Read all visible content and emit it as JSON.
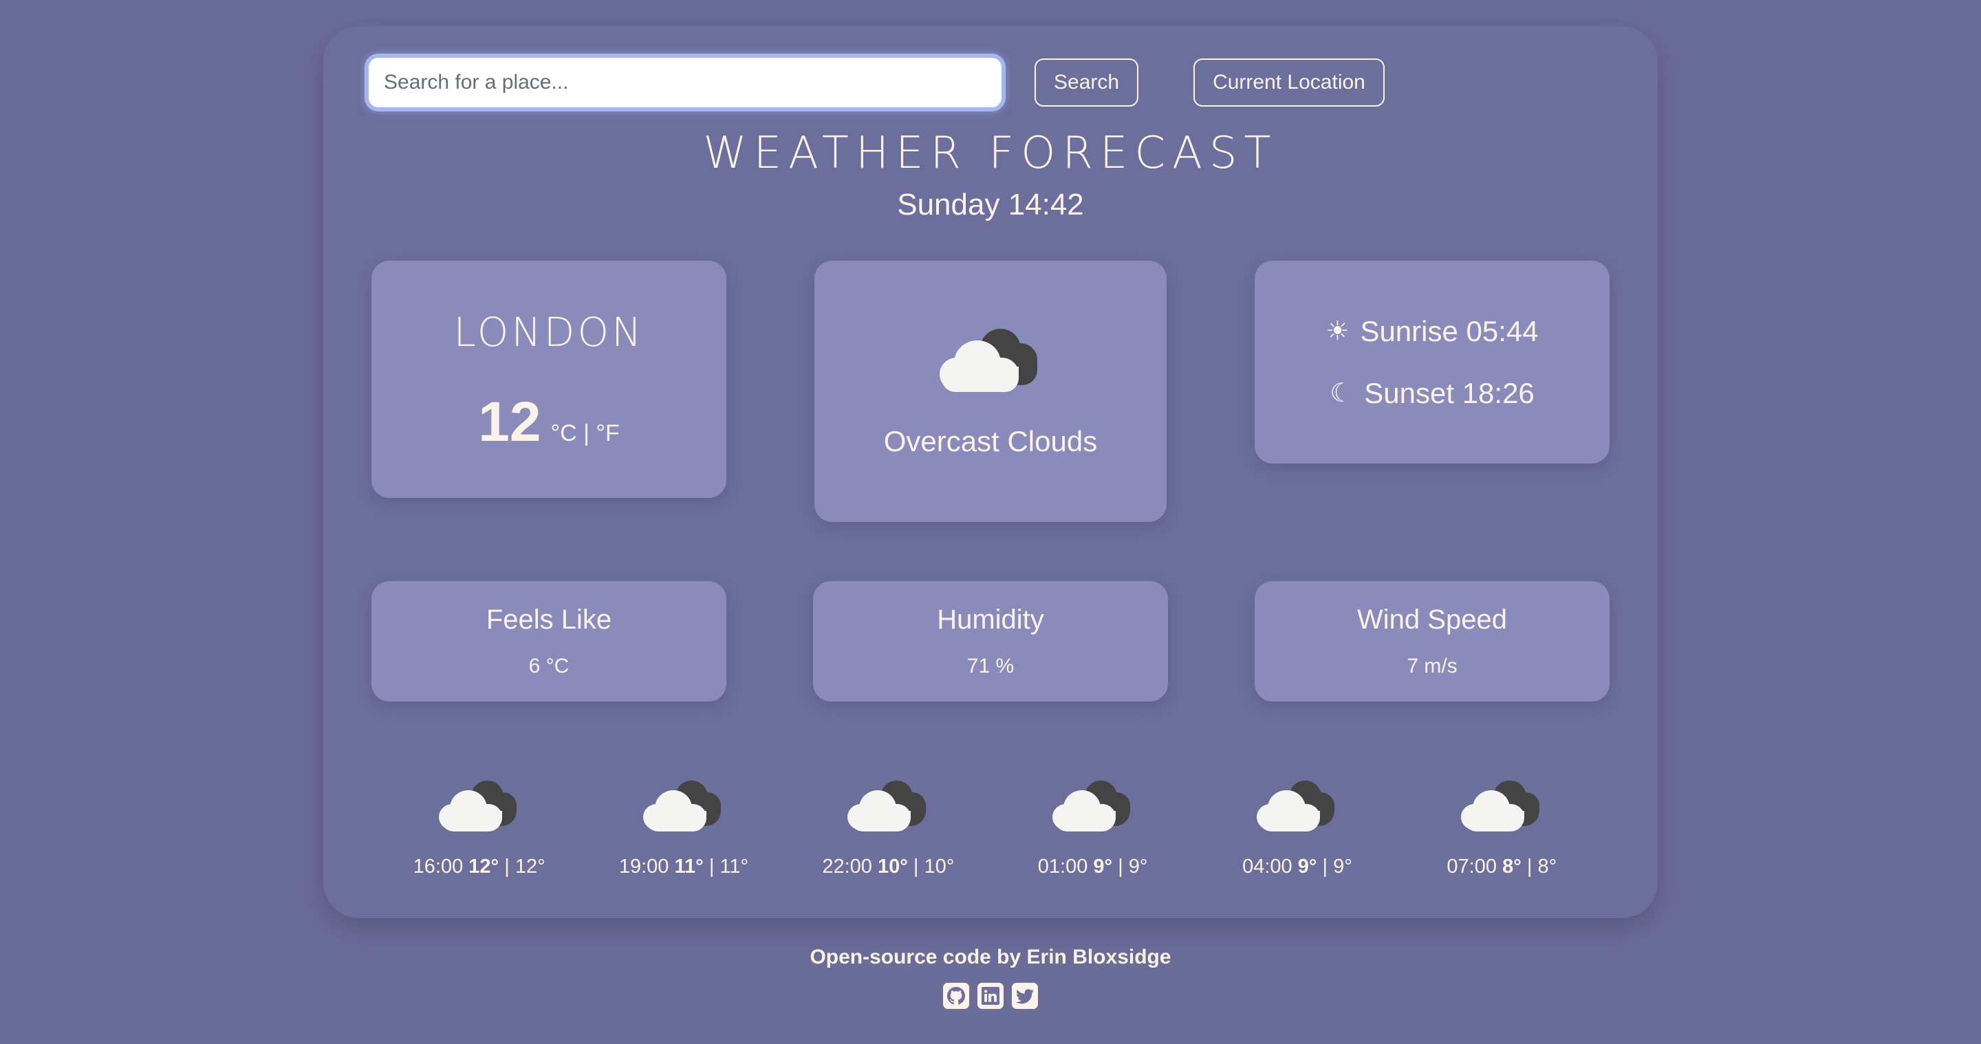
{
  "search": {
    "placeholder": "Search for a place...",
    "value": "",
    "search_label": "Search",
    "current_location_label": "Current Location"
  },
  "header": {
    "title": "WEATHER FORECAST",
    "datetime": "Sunday 14:42"
  },
  "location_card": {
    "city": "LONDON",
    "temperature": "12",
    "unit_toggle": "°C | °F"
  },
  "condition_card": {
    "icon": "overcast-clouds-icon",
    "description": "Overcast Clouds"
  },
  "sun_card": {
    "sunrise_icon": "sun-icon",
    "sunrise_glyph": "☀",
    "sunrise": "Sunrise 05:44",
    "sunset_icon": "moon-icon",
    "sunset_glyph": "☾",
    "sunset": "Sunset 18:26"
  },
  "stats": [
    {
      "label": "Feels Like",
      "value": "6 °C"
    },
    {
      "label": "Humidity",
      "value": "71 %"
    },
    {
      "label": "Wind Speed",
      "value": "7 m/s"
    }
  ],
  "forecast": [
    {
      "time": "16:00",
      "high": "12°",
      "low": "12°",
      "icon": "overcast-clouds-icon"
    },
    {
      "time": "19:00",
      "high": "11°",
      "low": "11°",
      "icon": "overcast-clouds-icon"
    },
    {
      "time": "22:00",
      "high": "10°",
      "low": "10°",
      "icon": "overcast-clouds-icon"
    },
    {
      "time": "01:00",
      "high": "9°",
      "low": "9°",
      "icon": "overcast-clouds-icon"
    },
    {
      "time": "04:00",
      "high": "9°",
      "low": "9°",
      "icon": "overcast-clouds-icon"
    },
    {
      "time": "07:00",
      "high": "8°",
      "low": "8°",
      "icon": "overcast-clouds-icon"
    }
  ],
  "footer": {
    "credit": "Open-source code by Erin Bloxsidge",
    "social": [
      {
        "name": "github-icon"
      },
      {
        "name": "linkedin-icon"
      },
      {
        "name": "twitter-icon"
      }
    ]
  },
  "colors": {
    "page_background": "#6B6D99",
    "container_background": "#6C6E9B",
    "card_background": "#8A8BBB",
    "text": "#FBF2EA",
    "cloud_light": "#F4F4F2",
    "cloud_dark": "#444444"
  }
}
